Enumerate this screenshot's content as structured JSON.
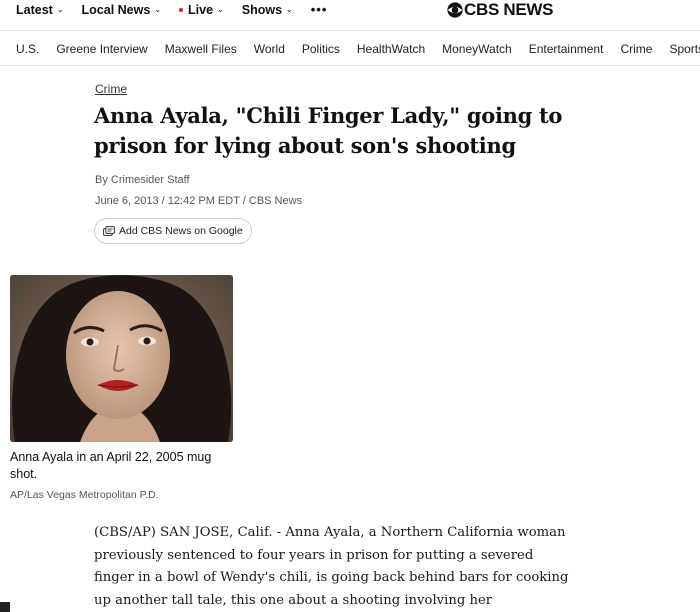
{
  "topnav": {
    "items": [
      {
        "label": "Latest",
        "chevron": true
      },
      {
        "label": "Local News",
        "chevron": true
      },
      {
        "label": "Live",
        "chevron": true,
        "live": true
      },
      {
        "label": "Shows",
        "chevron": true
      }
    ],
    "more_label": "•••"
  },
  "brand": {
    "name": "CBS NEWS",
    "icon": "cbs-eye-icon"
  },
  "sections": [
    "U.S.",
    "Greene Interview",
    "Maxwell Files",
    "World",
    "Politics",
    "HealthWatch",
    "MoneyWatch",
    "Entertainment",
    "Crime",
    "Sports"
  ],
  "article": {
    "kicker": "Crime",
    "headline": "Anna Ayala, \"Chili Finger Lady,\" going to prison for lying about son's shooting",
    "byline": "By Crimesider Staff",
    "dateline": "June 6, 2013 / 12:42 PM EDT / CBS News",
    "google_button": "Add CBS News on Google",
    "photo": {
      "caption": "Anna Ayala in an April 22, 2005 mug shot.",
      "credit": "AP/Las Vegas Metropolitan P.D."
    },
    "body": "(CBS/AP) SAN JOSE, Calif. - Anna Ayala, a Northern California woman previously sentenced to four years in prison for putting a severed finger in a bowl of Wendy's chili, is going back behind bars for cooking up another tall tale, this one about a shooting involving her"
  },
  "colors": {
    "live_dot": "#e01e1e",
    "text": "#101010",
    "border": "#e4e4e4"
  }
}
